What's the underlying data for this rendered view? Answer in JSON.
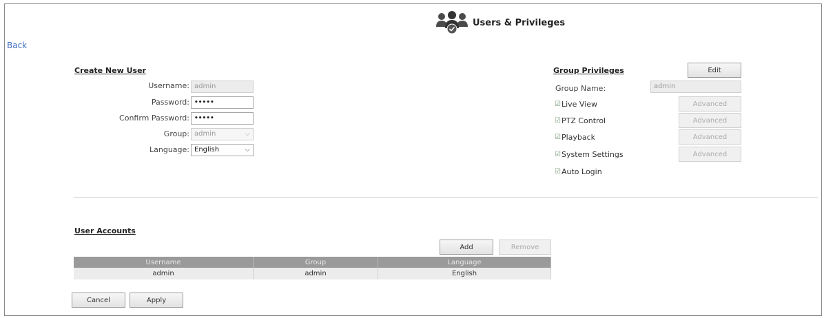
{
  "header": {
    "title": "Users & Privileges",
    "icon": "users-group-icon"
  },
  "nav": {
    "back_label": "Back"
  },
  "create_user": {
    "heading": "Create New User",
    "username_label": "Username:",
    "username_value": "admin",
    "password_label": "Password:",
    "password_value": "•••••",
    "confirm_label": "Confirm Password:",
    "confirm_value": "•••••",
    "group_label": "Group:",
    "group_value": "admin",
    "language_label": "Language:",
    "language_value": "English"
  },
  "group_privileges": {
    "heading": "Group Privileges",
    "edit_label": "Edit",
    "group_name_label": "Group Name:",
    "group_name_value": "admin",
    "items": [
      {
        "label": "Live View",
        "checked": true,
        "advanced_label": "Advanced"
      },
      {
        "label": "PTZ Control",
        "checked": true,
        "advanced_label": "Advanced"
      },
      {
        "label": "Playback",
        "checked": true,
        "advanced_label": "Advanced"
      },
      {
        "label": "System Settings",
        "checked": true,
        "advanced_label": "Advanced"
      },
      {
        "label": "Auto Login",
        "checked": true
      }
    ]
  },
  "accounts": {
    "heading": "User Accounts",
    "add_label": "Add",
    "remove_label": "Remove",
    "columns": [
      "Username",
      "Group",
      "Language"
    ],
    "rows": [
      [
        "admin",
        "admin",
        "English"
      ]
    ]
  },
  "footer": {
    "cancel_label": "Cancel",
    "apply_label": "Apply"
  },
  "colors": {
    "link": "#3f6fbf",
    "table_header": "#9a9a9a",
    "table_row": "#ececec"
  }
}
